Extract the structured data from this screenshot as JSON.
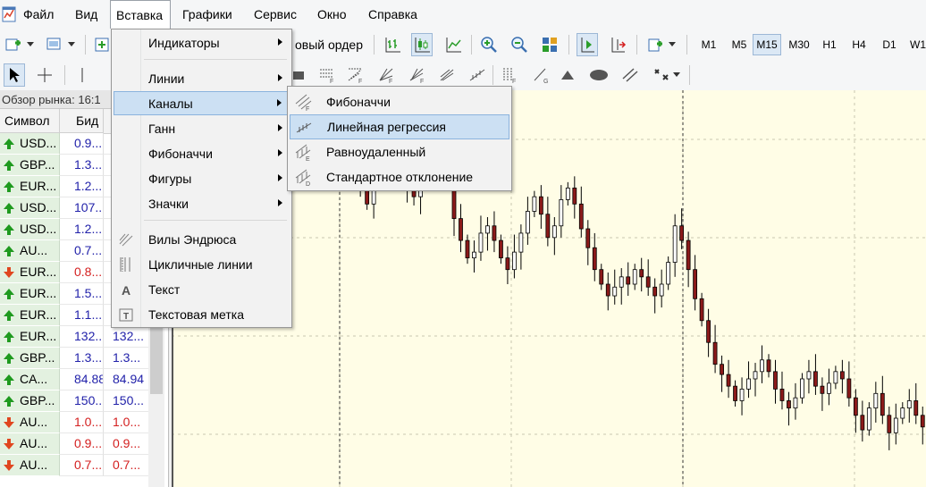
{
  "menubar": {
    "items": [
      "Файл",
      "Вид",
      "Вставка",
      "Графики",
      "Сервис",
      "Окно",
      "Справка"
    ],
    "active_index": 2
  },
  "toolbar": {
    "new_order": "овый ордер",
    "timeframes": [
      "M1",
      "M5",
      "M15",
      "M30",
      "H1",
      "H4",
      "D1",
      "W1"
    ],
    "active_timeframe": "M15"
  },
  "market_watch": {
    "title": "Обзор рынка: 16:1",
    "col_symbol": "Символ",
    "col_bid": "Бид",
    "rows": [
      {
        "symbol": "USD...",
        "bid": "0.9...",
        "ask": "",
        "dir": "up"
      },
      {
        "symbol": "GBP...",
        "bid": "1.3...",
        "ask": "",
        "dir": "up"
      },
      {
        "symbol": "EUR...",
        "bid": "1.2...",
        "ask": "",
        "dir": "up"
      },
      {
        "symbol": "USD...",
        "bid": "107...",
        "ask": "",
        "dir": "up"
      },
      {
        "symbol": "USD...",
        "bid": "1.2...",
        "ask": "",
        "dir": "up"
      },
      {
        "symbol": "AU...",
        "bid": "0.7...",
        "ask": "",
        "dir": "up"
      },
      {
        "symbol": "EUR...",
        "bid": "0.8...",
        "ask": "",
        "dir": "down"
      },
      {
        "symbol": "EUR...",
        "bid": "1.5...",
        "ask": "",
        "dir": "up"
      },
      {
        "symbol": "EUR...",
        "bid": "1.1...",
        "ask": "",
        "dir": "up"
      },
      {
        "symbol": "EUR...",
        "bid": "132...",
        "ask": "132...",
        "dir": "up"
      },
      {
        "symbol": "GBP...",
        "bid": "1.3...",
        "ask": "1.3...",
        "dir": "up"
      },
      {
        "symbol": "CA...",
        "bid": "84.88",
        "ask": "84.94",
        "dir": "up"
      },
      {
        "symbol": "GBP...",
        "bid": "150...",
        "ask": "150...",
        "dir": "up"
      },
      {
        "symbol": "AU...",
        "bid": "1.0...",
        "ask": "1.0...",
        "dir": "down"
      },
      {
        "symbol": "AU...",
        "bid": "0.9...",
        "ask": "0.9...",
        "dir": "down"
      },
      {
        "symbol": "AU...",
        "bid": "0.7...",
        "ask": "0.7...",
        "dir": "down"
      }
    ],
    "colors": {
      "up": "#2222aa",
      "down": "#d42020",
      "arrow_up": "#1f9a1f",
      "arrow_down": "#e0461f"
    }
  },
  "insert_menu": {
    "items": [
      {
        "label": "Индикаторы",
        "submenu": true,
        "icon": ""
      },
      {
        "label": "Линии",
        "submenu": true,
        "icon": ""
      },
      {
        "label": "Каналы",
        "submenu": true,
        "icon": ""
      },
      {
        "label": "Ганн",
        "submenu": true,
        "icon": ""
      },
      {
        "label": "Фибоначчи",
        "submenu": true,
        "icon": ""
      },
      {
        "label": "Фигуры",
        "submenu": true,
        "icon": ""
      },
      {
        "label": "Значки",
        "submenu": true,
        "icon": ""
      },
      {
        "label": "Вилы Эндрюса",
        "submenu": false,
        "icon": "andrews-pitchfork-icon"
      },
      {
        "label": "Цикличные линии",
        "submenu": false,
        "icon": "cycle-lines-icon"
      },
      {
        "label": "Текст",
        "submenu": false,
        "icon": "text-icon"
      },
      {
        "label": "Текстовая метка",
        "submenu": false,
        "icon": "text-label-icon"
      }
    ],
    "highlighted": "Каналы"
  },
  "channels_submenu": {
    "items": [
      {
        "label": "Фибоначчи",
        "icon": "fibonacci-channel-icon"
      },
      {
        "label": "Линейная регрессия",
        "icon": "linear-regression-icon"
      },
      {
        "label": "Равноудаленный",
        "icon": "equidistant-channel-icon"
      },
      {
        "label": "Стандартное отклонение",
        "icon": "std-deviation-channel-icon"
      }
    ],
    "highlighted": "Линейная регрессия"
  },
  "chart": {
    "background": "#fffde6",
    "grid_color": "#c8c8b0",
    "bull_color": "#ffffff",
    "bear_color": "#8b1a1a",
    "wick_color": "#000000",
    "closes": [
      1.263,
      1.2622,
      1.2628,
      1.2618,
      1.2624,
      1.2632,
      1.264,
      1.263,
      1.2612,
      1.2598,
      1.2585,
      1.26,
      1.2612,
      1.262,
      1.2628,
      1.261,
      1.2596,
      1.259,
      1.2605,
      1.2618,
      1.263,
      1.2622,
      1.26,
      1.2575,
      1.256,
      1.2548,
      1.2552,
      1.2565,
      1.257,
      1.256,
      1.2548,
      1.254,
      1.2552,
      1.2565,
      1.258,
      1.259,
      1.2578,
      1.2562,
      1.257,
      1.2588,
      1.2596,
      1.2585,
      1.2568,
      1.2555,
      1.254,
      1.253,
      1.2522,
      1.2528,
      1.2535,
      1.253,
      1.254,
      1.2535,
      1.2528,
      1.2522,
      1.253,
      1.2545,
      1.257,
      1.256,
      1.254,
      1.252,
      1.2505,
      1.249,
      1.2475,
      1.2468,
      1.246,
      1.245,
      1.2458,
      1.2465,
      1.247,
      1.2478,
      1.247,
      1.2458,
      1.245,
      1.2445,
      1.2452,
      1.2465,
      1.247,
      1.246,
      1.2455,
      1.2462,
      1.247,
      1.2465,
      1.2452,
      1.244,
      1.243,
      1.2445,
      1.2455,
      1.244,
      1.2428,
      1.2438,
      1.2445,
      1.245,
      1.244,
      1.2432
    ]
  }
}
